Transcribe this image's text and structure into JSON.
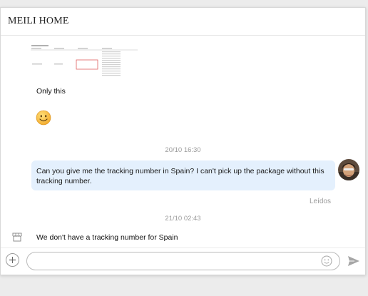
{
  "header": {
    "title": "MEILI HOME"
  },
  "messages": {
    "attachment_caption": "Only this",
    "timestamp_1": "20/10 16:30",
    "user_message": "Can you give me the tracking number in Spain? I can't pick up the package without this tracking number.",
    "read_status": "Leídos",
    "timestamp_2": "21/10 02:43",
    "seller_reply": "We don't have a tracking number for Spain"
  },
  "composer": {
    "placeholder": ""
  },
  "icons": {
    "smiley": "smiley-emoji",
    "shop": "shop-icon",
    "add": "plus-circle-icon",
    "emoji": "emoji-icon",
    "send": "send-icon"
  },
  "colors": {
    "bubble": "#e4f0fd",
    "meta_text": "#9a9a9a",
    "border": "#b9b9b9"
  }
}
